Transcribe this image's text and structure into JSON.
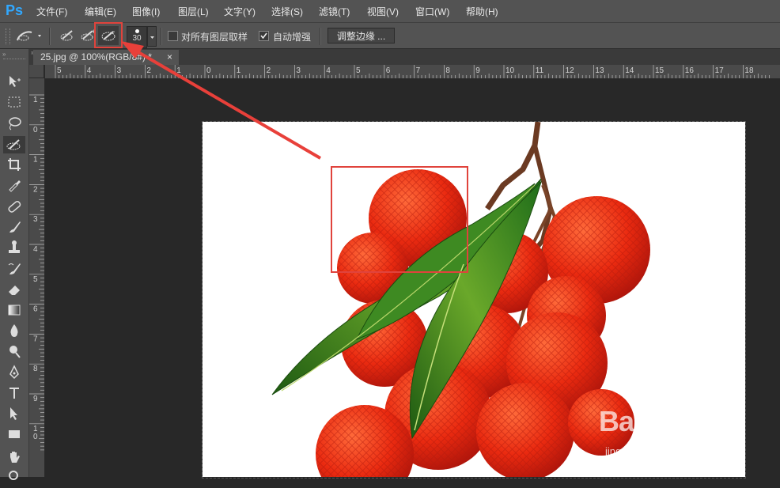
{
  "app": {
    "logo": "Ps"
  },
  "menu": [
    "文件(F)",
    "编辑(E)",
    "图像(I)",
    "图层(L)",
    "文字(Y)",
    "选择(S)",
    "滤镜(T)",
    "视图(V)",
    "窗口(W)",
    "帮助(H)"
  ],
  "options": {
    "brush_size": "30",
    "sample_all_layers": "对所有图层取样",
    "auto_enhance": "自动增强",
    "refine_edge": "调整边缘 ..."
  },
  "document": {
    "tab_title": "25.jpg @ 100%(RGB/8#) *",
    "close": "×"
  },
  "ruler_h": [
    "5",
    "4",
    "3",
    "2",
    "1",
    "0",
    "1",
    "2",
    "3",
    "4",
    "5",
    "6",
    "7",
    "8",
    "9",
    "10",
    "11",
    "12",
    "13",
    "14",
    "15",
    "16",
    "17",
    "18"
  ],
  "ruler_v": [
    "1",
    "0",
    "1",
    "2",
    "3",
    "4",
    "5",
    "6",
    "7",
    "8",
    "9",
    "1\n0"
  ],
  "watermark": {
    "brand": "Baidu经验",
    "url": "jingyan.baidu.com"
  },
  "colors": {
    "highlight": "#e0433c",
    "ps_blue": "#31a8ff"
  }
}
